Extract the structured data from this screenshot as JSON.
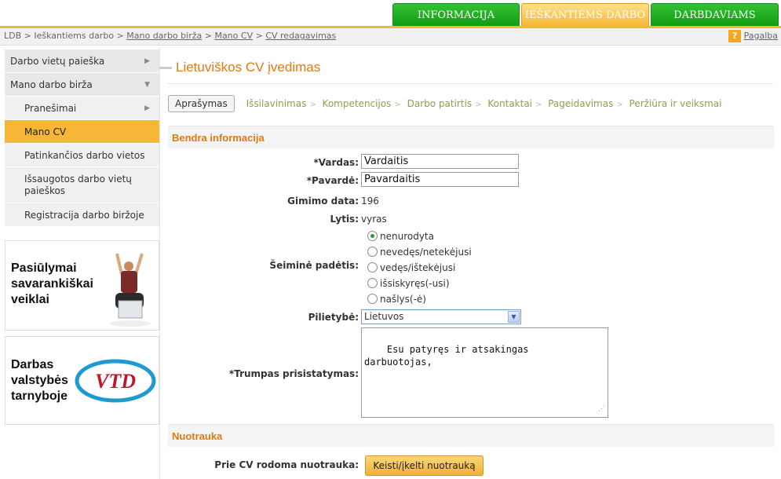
{
  "top_tabs": [
    {
      "label": "INFORMACIJA",
      "active": false
    },
    {
      "label": "IEŠKANTIEMS DARBO",
      "active": true
    },
    {
      "label": "DARBDAVIAMS",
      "active": false
    }
  ],
  "breadcrumb": {
    "items": [
      "LDB",
      "Ieškantiems darbo",
      "Mano darbo birža",
      "Mano CV",
      "CV redagavimas"
    ],
    "separator": ">"
  },
  "help": {
    "icon": "question-icon",
    "label": "Pagalba"
  },
  "sidebar": {
    "items": [
      {
        "label": "Darbo vietų paieška",
        "arrow": "▶"
      },
      {
        "label": "Mano darbo birža",
        "arrow": "▼"
      },
      {
        "label": "Pranešimai",
        "arrow": "▶"
      },
      {
        "label": "Mano CV"
      },
      {
        "label": "Patinkančios darbo vietos"
      },
      {
        "label": "Išsaugotos darbo vietų paieškos"
      },
      {
        "label": "Registracija darbo biržoje"
      }
    ]
  },
  "promos": [
    {
      "text": "Pasiūlymai savarankiškai veiklai",
      "image": "person-with-laptop"
    },
    {
      "text": "Darbas valstybės tarnyboje",
      "image": "vtd-logo",
      "logo_text": "VTD"
    }
  ],
  "main": {
    "title": "Lietuviškos CV įvedimas",
    "steps": [
      "Aprašymas",
      "Išsilavinimas",
      "Kompetencijos",
      "Darbo patirtis",
      "Kontaktai",
      "Pageidavimas",
      "Peržiūra ir veiksmai"
    ],
    "steps_separator": ">"
  },
  "section_general": {
    "title": "Bendra informacija",
    "first_name_label": "*Vardas:",
    "first_name_value": "Vardaitis",
    "last_name_label": "*Pavardė:",
    "last_name_value": "Pavardaitis",
    "birth_label": "Gimimo data:",
    "birth_value": "196",
    "gender_label": "Lytis:",
    "gender_value": "vyras",
    "marital_label": "Šeiminė padėtis:",
    "marital_options": [
      "nenurodyta",
      "nevedęs/netekėjusi",
      "vedęs/ištekėjusi",
      "išsiskyręs(-usi)",
      "našlys(-ė)"
    ],
    "marital_selected": 0,
    "citizenship_label": "Pilietybė:",
    "citizenship_value": "Lietuvos",
    "summary_label": "*Trumpas prisistatymas:",
    "summary_value": "Esu patyręs ir atsakingas\ndarbuotojas,"
  },
  "section_photo": {
    "title": "Nuotrauka",
    "photo_label": "Prie CV rodoma nuotrauka:",
    "photo_button": "Keisti/įkelti nuotrauką"
  },
  "colors": {
    "tab_green": "#1aa51a",
    "tab_active": "#f5b735",
    "title_orange": "#e07a10",
    "steps_green": "#8aa24a"
  }
}
